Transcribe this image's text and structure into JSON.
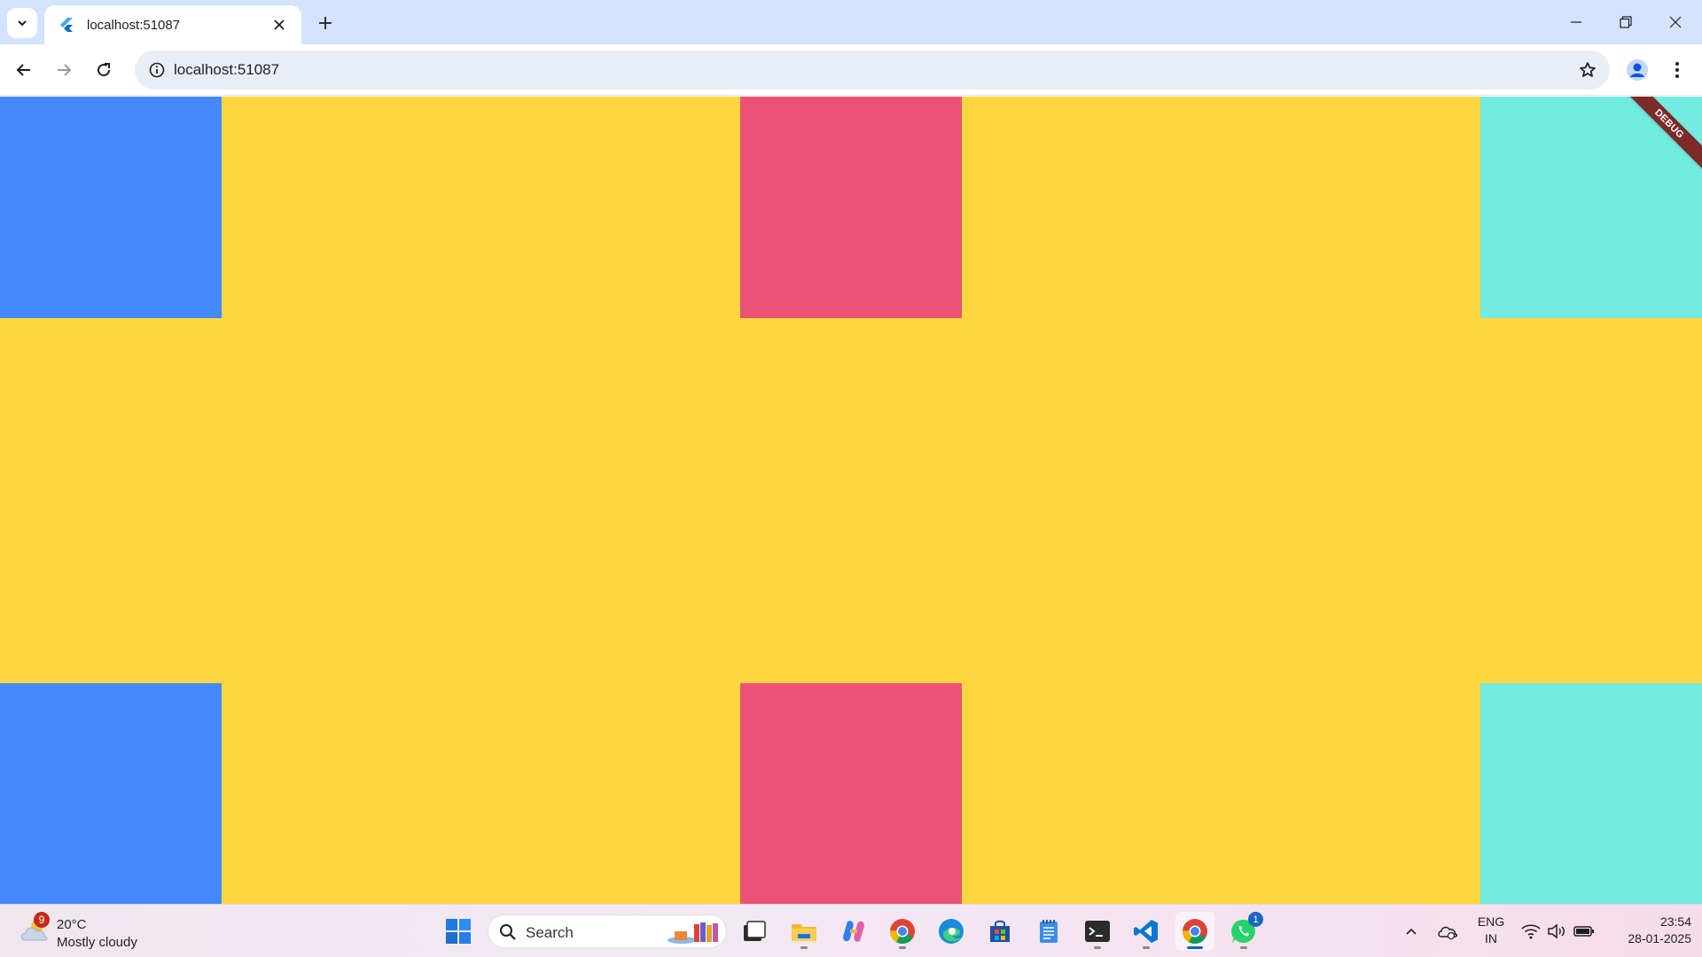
{
  "browser": {
    "tab": {
      "title": "localhost:51087"
    },
    "omnibox": {
      "url": "localhost:51087"
    }
  },
  "app": {
    "colors": {
      "background": "#fed640",
      "blue": "#4489fd",
      "pink": "#eb5275",
      "teal": "#72ebe0"
    },
    "debug_banner": "DEBUG"
  },
  "taskbar": {
    "weather": {
      "badge": "9",
      "temperature": "20°C",
      "condition": "Mostly cloudy"
    },
    "search": {
      "label": "Search"
    },
    "whatsapp_badge": "1",
    "language": {
      "line1": "ENG",
      "line2": "IN"
    },
    "clock": {
      "time": "23:54",
      "date": "28-01-2025"
    }
  }
}
